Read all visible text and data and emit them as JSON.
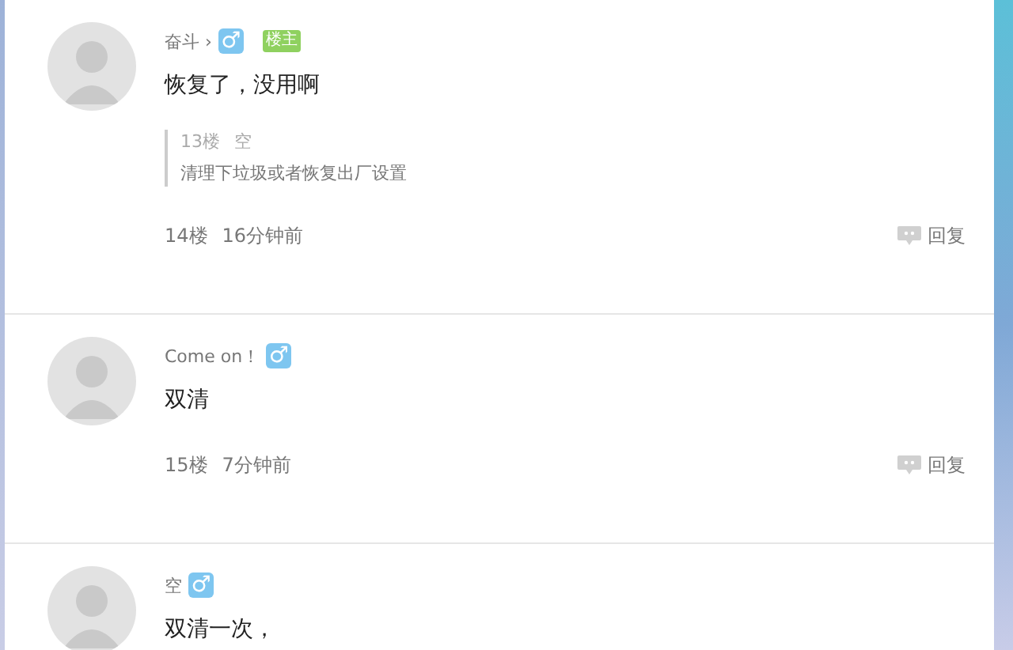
{
  "posts": [
    {
      "author": "奋斗 ›",
      "gender_symbol": "♂",
      "op_badge": "楼主",
      "content": "恢复了，没用啊",
      "quote": {
        "floor": "13楼",
        "author": "空",
        "text": "清理下垃圾或者恢复出厂设置"
      },
      "floor": "14楼",
      "time": "16分钟前",
      "reply": "回复"
    },
    {
      "author": "Come on！",
      "gender_symbol": "♂",
      "content": "双清",
      "floor": "15楼",
      "time": "7分钟前",
      "reply": "回复"
    },
    {
      "author": "空",
      "gender_symbol": "♂",
      "content": "双清一次，"
    }
  ]
}
